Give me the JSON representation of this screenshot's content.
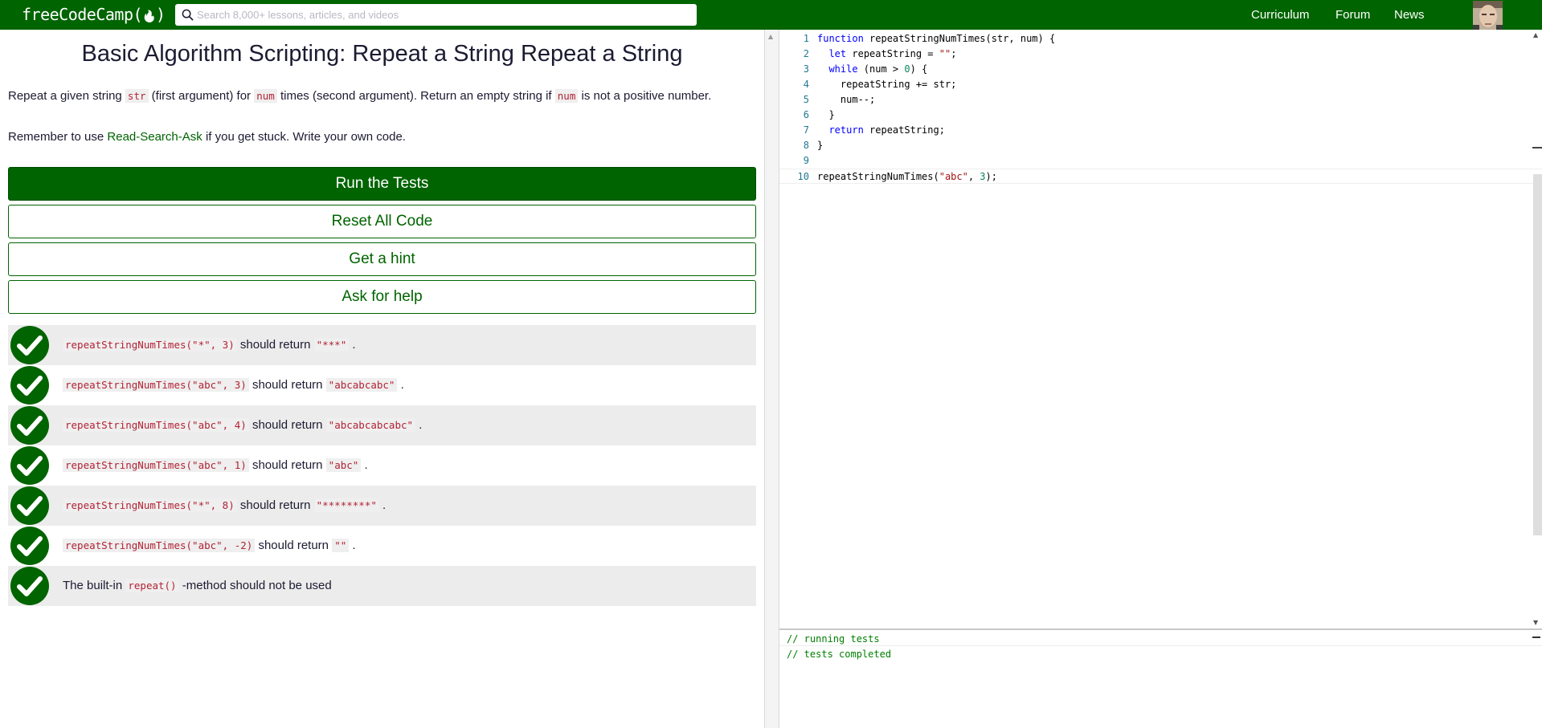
{
  "navbar": {
    "logo_text": "freeCodeCamp(",
    "logo_flame": "🔥",
    "logo_close": ")",
    "search_placeholder": "Search 8,000+ lessons, articles, and videos",
    "links": {
      "curriculum": "Curriculum",
      "forum": "Forum",
      "news": "News"
    },
    "brand_color": "#006400"
  },
  "challenge": {
    "title": "Basic Algorithm Scripting: Repeat a String Repeat a String",
    "description": {
      "t1": "Repeat a given string ",
      "c1": "str",
      "t2": " (first argument) for ",
      "c2": "num",
      "t3": " times (second argument). Return an empty string if ",
      "c3": "num",
      "t4": " is not a positive number."
    },
    "reminder": {
      "before": "Remember to use ",
      "link": "Read-Search-Ask",
      "after": " if you get stuck. Write your own code."
    }
  },
  "buttons": {
    "run": "Run the Tests",
    "reset": "Reset All Code",
    "hint": "Get a hint",
    "help": "Ask for help"
  },
  "tests": [
    {
      "code": "repeatStringNumTimes(\"*\", 3)",
      "mid": " should return ",
      "result": "\"***\"",
      "end": " .",
      "passed": true
    },
    {
      "code": "repeatStringNumTimes(\"abc\", 3)",
      "mid": " should return ",
      "result": "\"abcabcabc\"",
      "end": " .",
      "passed": true
    },
    {
      "code": "repeatStringNumTimes(\"abc\", 4)",
      "mid": " should return ",
      "result": "\"abcabcabcabc\"",
      "end": " .",
      "passed": true
    },
    {
      "code": "repeatStringNumTimes(\"abc\", 1)",
      "mid": " should return ",
      "result": "\"abc\"",
      "end": " .",
      "passed": true
    },
    {
      "code": "repeatStringNumTimes(\"*\", 8)",
      "mid": " should return ",
      "result": "\"********\"",
      "end": " .",
      "passed": true
    },
    {
      "code": "repeatStringNumTimes(\"abc\", -2)",
      "mid": " should return ",
      "result": "\"\"",
      "end": " .",
      "passed": true
    },
    {
      "pre": "The built-in ",
      "code": "repeat()",
      "post": " -method should not be used",
      "passed": true
    }
  ],
  "editor": {
    "line_numbers": [
      "1",
      "2",
      "3",
      "4",
      "5",
      "6",
      "7",
      "8",
      "9",
      "10"
    ],
    "lines": [
      {
        "tokens": [
          [
            "kw",
            "function"
          ],
          [
            "",
            "  repeatStringNumTimes(str, num) {"
          ]
        ]
      },
      {
        "tokens": [
          [
            "",
            "  "
          ],
          [
            "kw",
            "let"
          ],
          [
            "",
            " repeatString = "
          ],
          [
            "str",
            "\"\""
          ],
          [
            "",
            ";"
          ]
        ]
      },
      {
        "tokens": [
          [
            "",
            "  "
          ],
          [
            "kw",
            "while"
          ],
          [
            "",
            " (num > "
          ],
          [
            "num",
            "0"
          ],
          [
            "",
            ") {"
          ]
        ]
      },
      {
        "tokens": [
          [
            "",
            "    repeatString += str;"
          ]
        ]
      },
      {
        "tokens": [
          [
            "",
            "    num--;"
          ]
        ]
      },
      {
        "tokens": [
          [
            "",
            "  }"
          ]
        ]
      },
      {
        "tokens": [
          [
            "",
            "  "
          ],
          [
            "kw",
            "return"
          ],
          [
            "",
            " repeatString;"
          ]
        ]
      },
      {
        "tokens": [
          [
            "",
            "}"
          ]
        ]
      },
      {
        "tokens": [
          [
            "",
            ""
          ]
        ]
      },
      {
        "tokens": [
          [
            "",
            "repeatStringNumTimes("
          ],
          [
            "str",
            "\"abc\""
          ],
          [
            "",
            ", "
          ],
          [
            "num",
            "3"
          ],
          [
            "",
            ");"
          ]
        ]
      }
    ]
  },
  "output": {
    "lines": [
      "// running tests",
      "// tests completed"
    ]
  }
}
